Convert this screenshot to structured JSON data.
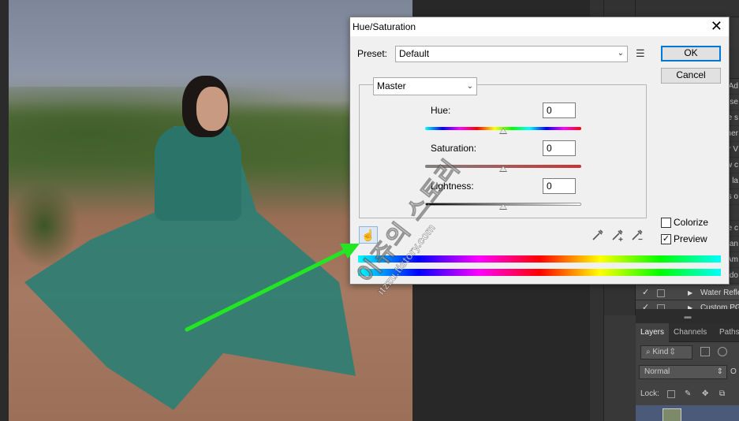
{
  "dialog": {
    "title": "Hue/Saturation",
    "preset_label": "Preset:",
    "preset_value": "Default",
    "ok_label": "OK",
    "cancel_label": "Cancel",
    "channel_value": "Master",
    "hue_label": "Hue:",
    "hue_value": "0",
    "saturation_label": "Saturation:",
    "saturation_value": "0",
    "lightness_label": "Lightness:",
    "lightness_value": "0",
    "colorize_label": "Colorize",
    "colorize_checked": false,
    "preview_label": "Preview",
    "preview_checked": true,
    "hue_level": 0.5,
    "saturation_level": 0.5,
    "lightness_level": 0.5
  },
  "layers_panel": {
    "adjustment_rows": [
      "Ad",
      "(se",
      "e s",
      "Ther",
      "r V",
      "w c",
      "e la",
      "rs o",
      "",
      "e c",
      "nan",
      "Am",
      "odo"
    ],
    "layer_rows": [
      {
        "visible": true,
        "name": "Water Refle"
      },
      {
        "visible": true,
        "name": "Custom PG"
      }
    ],
    "tabs": [
      "Layers",
      "Channels",
      "Paths"
    ],
    "active_tab": "Layers",
    "kind_label": "Kind",
    "blend_mode": "Normal",
    "opacity_abbr": "O",
    "lock_label": "Lock:"
  },
  "watermark": {
    "line1": "이쥬의 스토리",
    "line2": "itzzu.tistory.com"
  },
  "colors": {
    "annotation_arrow": "#22e622",
    "dialog_bg": "#f0f0f0",
    "ok_border": "#0078d7"
  }
}
